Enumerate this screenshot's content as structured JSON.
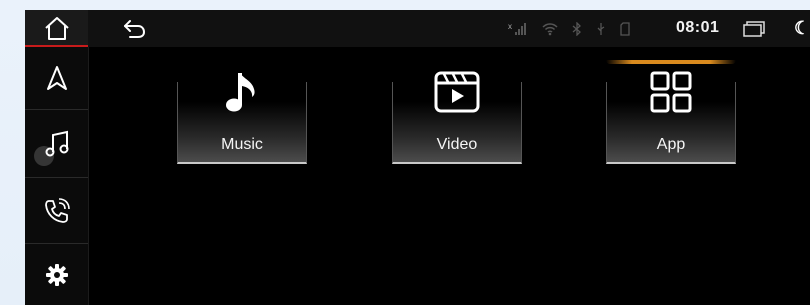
{
  "status_bar": {
    "time": "08:01",
    "signal_icon": "signal-off-icon",
    "wifi_icon": "wifi-icon",
    "bluetooth_icon": "bluetooth-icon",
    "usb_icon": "usb-icon",
    "sd_icon": "sd-card-icon",
    "window_icon": "window-icon",
    "moon_icon": "moon-icon",
    "back_icon": "back-arrow-icon"
  },
  "sidebar": {
    "items": [
      {
        "name": "home",
        "icon": "home-icon",
        "active": true
      },
      {
        "name": "navigation",
        "icon": "navigation-arrow-icon"
      },
      {
        "name": "music",
        "icon": "music-note-icon"
      },
      {
        "name": "phone",
        "icon": "phone-icon"
      },
      {
        "name": "settings",
        "icon": "gear-icon"
      }
    ]
  },
  "tiles": [
    {
      "label": "Music",
      "icon": "music-note-icon"
    },
    {
      "label": "Video",
      "icon": "video-icon"
    },
    {
      "label": "App",
      "icon": "grid-icon",
      "highlighted": true
    }
  ],
  "colors": {
    "accent_red": "#c81b1b",
    "highlight_orange": "#d98a1e",
    "background": "#000000"
  }
}
